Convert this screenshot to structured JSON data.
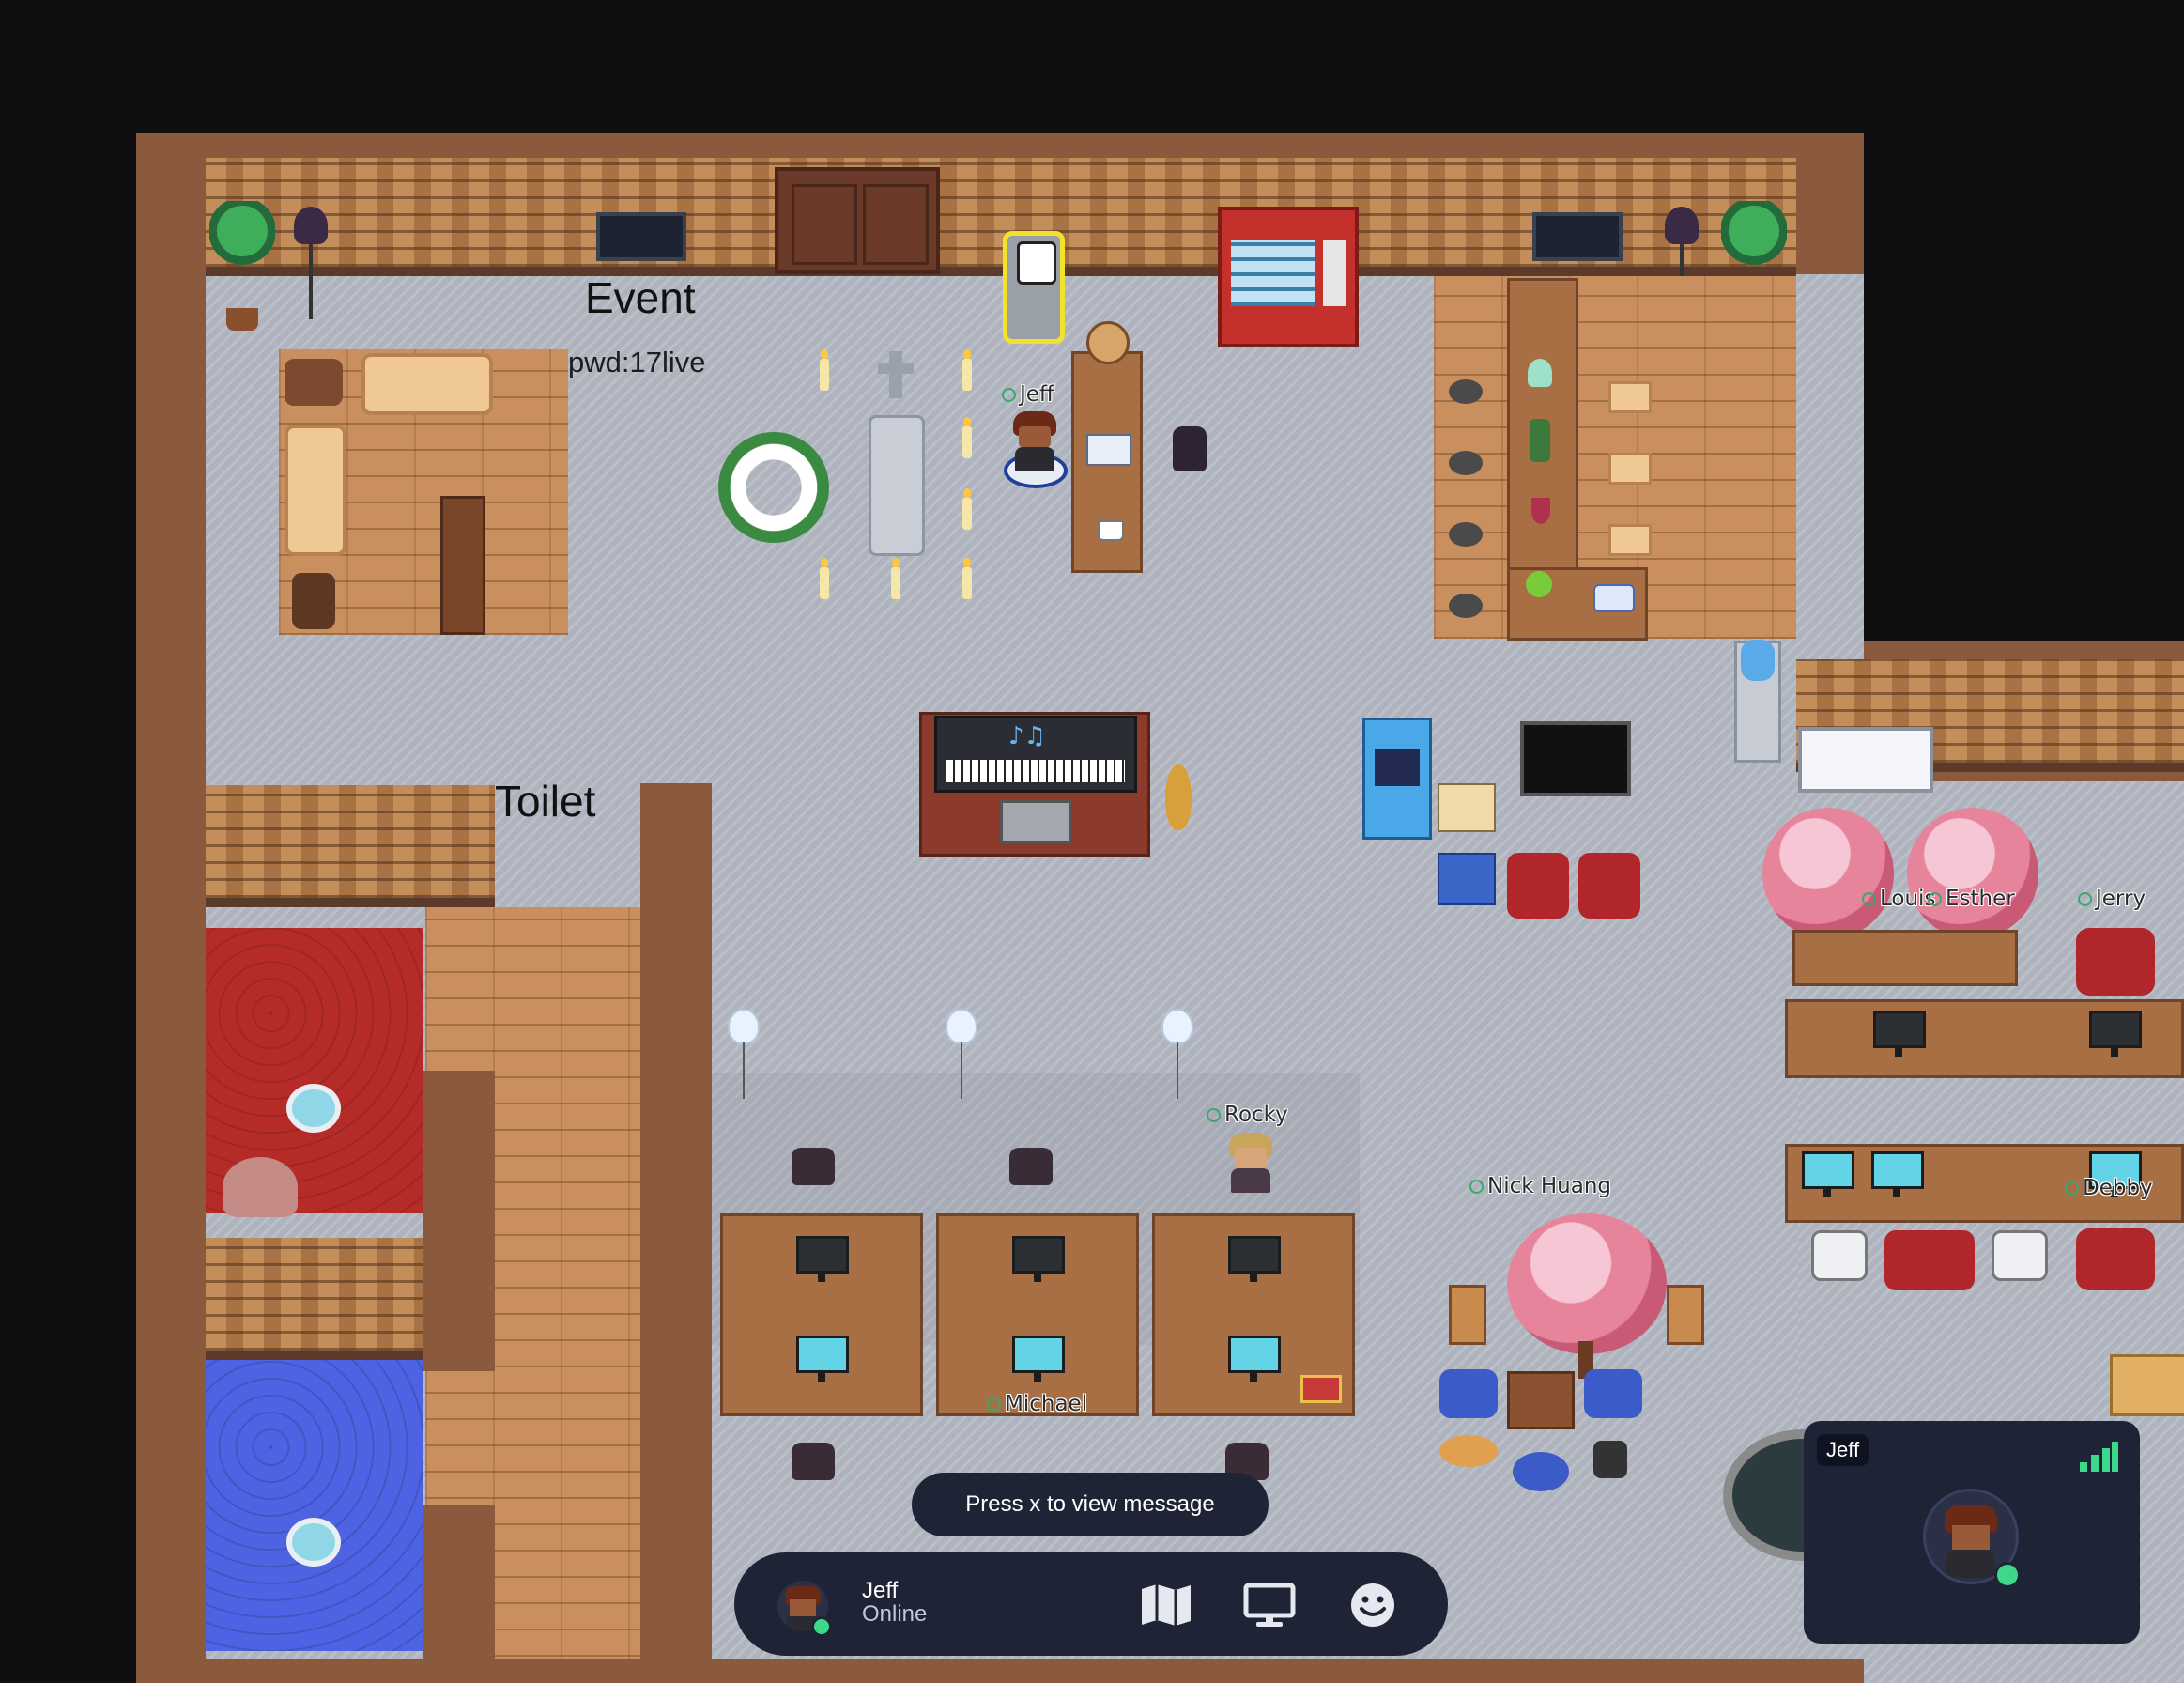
{
  "map": {
    "rooms": {
      "event_label": "Event",
      "event_password": "pwd:17live",
      "toilet_label": "Toilet"
    },
    "players": {
      "jeff": "Jeff",
      "rocky": "Rocky",
      "nick": "Nick Huang",
      "michael": "Michael",
      "louis": "Louis",
      "esther": "Esther",
      "jerry": "Jerry",
      "debby": "Debby"
    }
  },
  "toast": {
    "text": "Press x to view message"
  },
  "dock": {
    "user_name": "Jeff",
    "user_status": "Online",
    "buttons": [
      {
        "icon": "map-icon"
      },
      {
        "icon": "screen-share-icon"
      },
      {
        "icon": "emoji-icon"
      }
    ]
  },
  "video_card": {
    "name": "Jeff",
    "signal_icon": "signal-bars-icon"
  },
  "colors": {
    "frame": "#8b5a3c",
    "floor": "#aeb3bd",
    "ui_dark": "#1f2336",
    "online": "#3ed88a"
  }
}
